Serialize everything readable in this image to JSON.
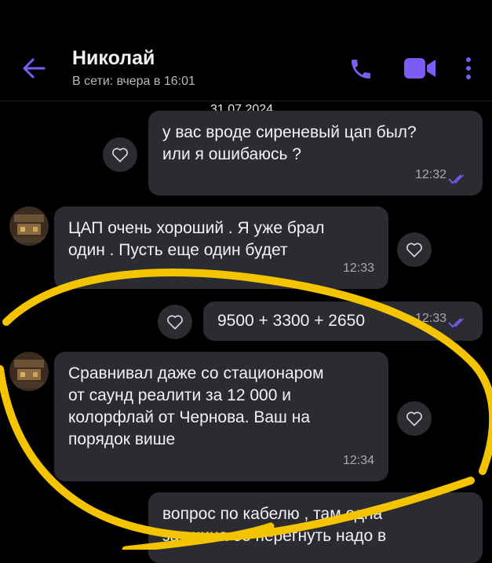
{
  "header": {
    "contact_name": "Николай",
    "status": "В сети: вчера в 16:01",
    "accent": "#7c5cf5"
  },
  "date_separator": "31.07.2024",
  "messages": [
    {
      "direction": "outgoing",
      "text": "у вас вроде сиреневый цап был?\nили я ошибаюсь ?",
      "time": "12:32",
      "read": true
    },
    {
      "direction": "incoming",
      "text": "ЦАП очень хороший . Я уже брал\nодин . Пусть еще один будет",
      "time": "12:33"
    },
    {
      "direction": "outgoing",
      "text": "9500 + 3300 + 2650",
      "time": "12:33",
      "read": true
    },
    {
      "direction": "incoming",
      "text": "Сравнивал даже со стационаром\nот саунд реалити за 12 000 и\nколорфлай от Чернова. Ваш на\nпорядок више",
      "time": "12:34"
    },
    {
      "direction": "outgoing",
      "text": "вопрос по кабелю , там одна\nзаушина ее перегнуть надо в",
      "time": ""
    }
  ],
  "annotation_color": "#f5c400"
}
